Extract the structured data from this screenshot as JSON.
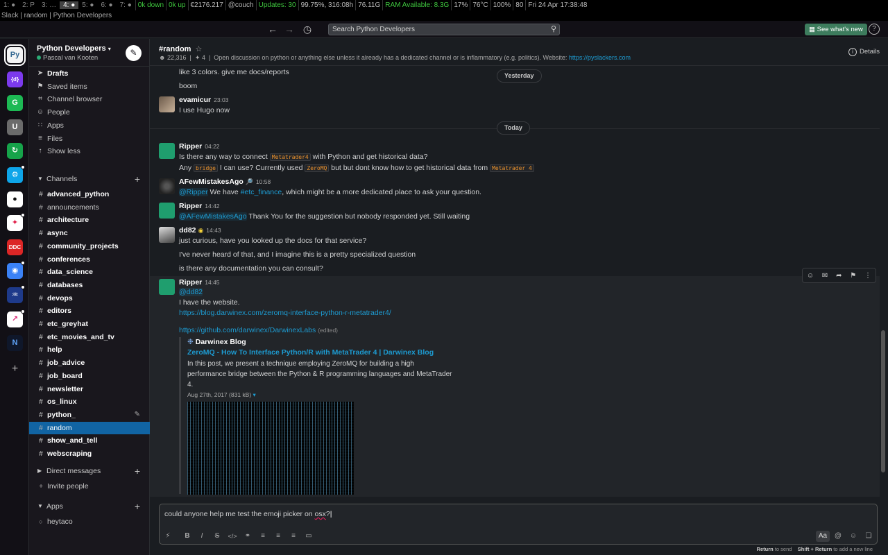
{
  "sysbar": {
    "workspaces": [
      "1: ●",
      "2: P",
      "3: …",
      "4: ●",
      "5: ●",
      "6: ●",
      "7: ●"
    ],
    "active_ws": "4: ●",
    "down": "0k down",
    "up": "0k up",
    "balance": "€2176.217",
    "host": "@couch",
    "updates": "Updates: 30",
    "battery": "99.75%, 316:08h",
    "disk": "76.11G",
    "ram": "RAM Available: 8.3G",
    "cpu": "17%",
    "temp": "76°C",
    "brightness": "100%",
    "volume": "80",
    "datetime": "Fri 24 Apr 17:38:48"
  },
  "window_title": "Slack | random | Python Developers",
  "topbar": {
    "search_placeholder": "Search Python Developers",
    "whats_new": "See what's new",
    "help": "?"
  },
  "rail": {
    "add": "+",
    "workspaces": [
      {
        "label": "Py",
        "color": "#f5f5f5",
        "text_color": "#336791"
      },
      {
        "label": "{d}",
        "color": "#7c3aed",
        "text_color": "#ffffff"
      },
      {
        "label": "G",
        "color": "#1db954",
        "text_color": "#ffffff"
      },
      {
        "label": "U",
        "color": "#6b6b6b",
        "text_color": "#ffffff"
      },
      {
        "label": "↻",
        "color": "#16a34a",
        "text_color": "#ffffff"
      },
      {
        "label": "⚙",
        "color": "#0ea5e9",
        "text_color": "#ffffff"
      },
      {
        "label": "●",
        "color": "#ffffff",
        "text_color": "#111111"
      },
      {
        "label": "✦",
        "color": "#ffffff",
        "text_color": "#e11d48"
      },
      {
        "label": "DDC",
        "color": "#dc2626",
        "text_color": "#ffffff"
      },
      {
        "label": "◉",
        "color": "#3b82f6",
        "text_color": "#ffffff"
      },
      {
        "label": "♒",
        "color": "#1e3a8a",
        "text_color": "#ffffff"
      },
      {
        "label": "↗",
        "color": "#ffffff",
        "text_color": "#db2777"
      },
      {
        "label": "N",
        "color": "#0f172a",
        "text_color": "#60a5fa"
      }
    ]
  },
  "sidebar": {
    "workspace_name": "Python Developers",
    "user": "Pascal van Kooten",
    "nav": [
      {
        "label": "Drafts",
        "icon": "➤"
      },
      {
        "label": "Saved items",
        "icon": "⚑"
      },
      {
        "label": "Channel browser",
        "icon": "⌗"
      },
      {
        "label": "People",
        "icon": "☺"
      },
      {
        "label": "Apps",
        "icon": "∷"
      },
      {
        "label": "Files",
        "icon": "≡"
      },
      {
        "label": "Show less",
        "icon": "↑"
      }
    ],
    "channels_label": "Channels",
    "channels": [
      {
        "name": "advanced_python",
        "unread": true
      },
      {
        "name": "announcements",
        "unread": false
      },
      {
        "name": "architecture",
        "unread": true
      },
      {
        "name": "async",
        "unread": true
      },
      {
        "name": "community_projects",
        "unread": true
      },
      {
        "name": "conferences",
        "unread": true
      },
      {
        "name": "data_science",
        "unread": true
      },
      {
        "name": "databases",
        "unread": true
      },
      {
        "name": "devops",
        "unread": true
      },
      {
        "name": "editors",
        "unread": true
      },
      {
        "name": "etc_greyhat",
        "unread": true
      },
      {
        "name": "etc_movies_and_tv",
        "unread": true
      },
      {
        "name": "help",
        "unread": true
      },
      {
        "name": "job_advice",
        "unread": true
      },
      {
        "name": "job_board",
        "unread": true
      },
      {
        "name": "newsletter",
        "unread": true
      },
      {
        "name": "os_linux",
        "unread": true
      },
      {
        "name": "python_",
        "unread": true
      },
      {
        "name": "random",
        "unread": false
      },
      {
        "name": "show_and_tell",
        "unread": true
      },
      {
        "name": "webscraping",
        "unread": true
      }
    ],
    "dm_label": "Direct messages",
    "invite_label": "Invite people",
    "apps_label": "Apps",
    "app_item": "heytaco"
  },
  "channel": {
    "name": "#random",
    "members": "22,316",
    "pins": "4",
    "topic": "Open discussion on python or anything else unless it already has a dedicated channel or is inflammatory (e.g. politics). Website:",
    "website": "https://pyslackers.com",
    "details": "Details"
  },
  "messages": {
    "top_line_1": "like 3 colors. give me docs/reports",
    "top_line_2": "boom",
    "day_yesterday": "Yesterday",
    "evamicur_name": "evamicur",
    "evamicur_time": "23:03",
    "evamicur_text": "I use Hugo now",
    "day_today": "Today",
    "m1": {
      "name": "Ripper",
      "time": "04:22",
      "l1a": "Is there any way to connect",
      "l1code": "Metatrader4",
      "l1b": "with Python and get historical data?",
      "l2a": "Any",
      "l2code1": "bridge",
      "l2b": "I can use? Currently used",
      "l2code2": "ZeroMQ",
      "l2c": "but but dont know how to get historical data from",
      "l2code3": "Metatrader 4"
    },
    "m2": {
      "name": "AFewMistakesAgo",
      "badge": "🔎",
      "time": "10:58",
      "mention": "@Ripper",
      "a": "We have",
      "chan": "#etc_finance",
      "b": ", which might be a more dedicated place to ask your question."
    },
    "m3": {
      "name": "Ripper",
      "time": "14:42",
      "mention": "@AFewMistakesAgo",
      "text": "Thank You for the suggestion but nobody responded yet. Still waiting"
    },
    "m4": {
      "name": "dd82",
      "time": "14:43",
      "l1": "just curious, have you looked up the docs for that service?",
      "l2": "I've never heard of that, and I imagine this is a pretty specialized question",
      "l3": "is there any documentation you can consult?"
    },
    "m5": {
      "name": "Ripper",
      "time": "14:45",
      "mention": "@dd82",
      "l1": "I have the website.",
      "link1": "https://blog.darwinex.com/zeromq-interface-python-r-metatrader4/",
      "link2": "https://github.com/darwinex/DarwinexLabs",
      "edited": "(edited)",
      "unfurl_site": "Darwinex Blog",
      "unfurl_title": "ZeroMQ - How To Interface Python/R with MetaTrader 4 | Darwinex Blog",
      "unfurl_desc_1": "In this post, we present a technique employing ZeroMQ for building a high",
      "unfurl_desc_2": "performance bridge between the Python & R programming languages and MetaTrader",
      "unfurl_desc_3": "4.",
      "unfurl_date": "Aug 27th, 2017",
      "unfurl_size": "(831 kB)"
    }
  },
  "composer": {
    "text_a": "could anyone help me test the emoji picker on",
    "text_b": "osx",
    "text_c": "?",
    "hint_send": "Return",
    "hint_send_label": "to send",
    "hint_newline": "Shift + Return",
    "hint_newline_label": "to add a new line",
    "aa": "Aa"
  }
}
